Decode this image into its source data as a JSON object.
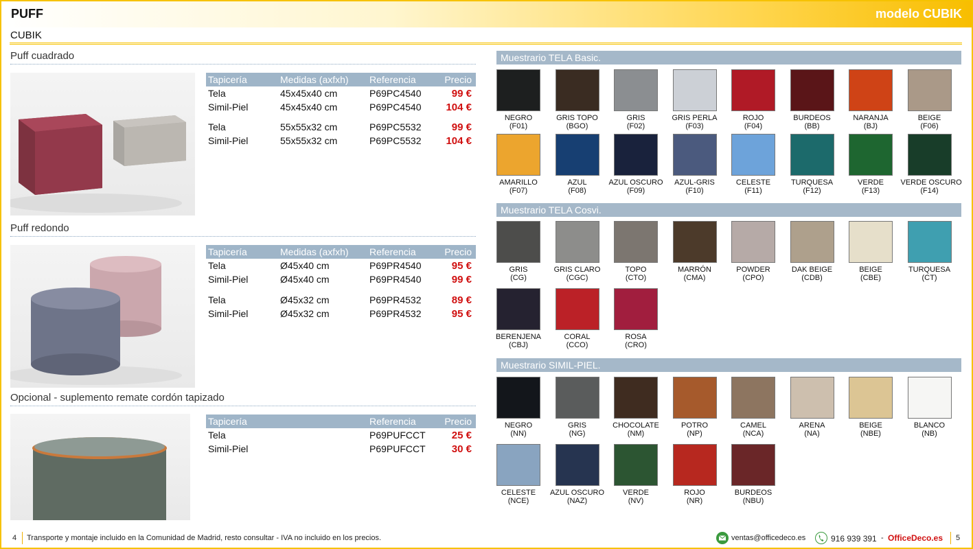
{
  "header": {
    "title": "PUFF",
    "model": "modelo CUBIK"
  },
  "subtitle": "CUBIK",
  "sections": [
    {
      "title": "Puff cuadrado",
      "headers": [
        "Tapicería",
        "Medidas (axfxh)",
        "Referencia",
        "Precio"
      ],
      "rows": [
        [
          "Tela",
          "45x45x40 cm",
          "P69PC4540",
          "99 €"
        ],
        [
          "Simil-Piel",
          "45x45x40 cm",
          "P69PC4540",
          "104 €"
        ],
        [
          "Tela",
          "55x55x32 cm",
          "P69PC5532",
          "99 €"
        ],
        [
          "Simil-Piel",
          "55x55x32 cm",
          "P69PC5532",
          "104 €"
        ]
      ]
    },
    {
      "title": "Puff redondo",
      "headers": [
        "Tapicería",
        "Medidas (axfxh)",
        "Referencia",
        "Precio"
      ],
      "rows": [
        [
          "Tela",
          "Ø45x40 cm",
          "P69PR4540",
          "95 €"
        ],
        [
          "Simil-Piel",
          "Ø45x40 cm",
          "P69PR4540",
          "99 €"
        ],
        [
          "Tela",
          "Ø45x32 cm",
          "P69PR4532",
          "89 €"
        ],
        [
          "Simil-Piel",
          "Ø45x32 cm",
          "P69PR4532",
          "95 €"
        ]
      ]
    },
    {
      "title": "Opcional - suplemento remate cordón tapizado",
      "headers": [
        "Tapicería",
        "Referencia",
        "Precio"
      ],
      "rows": [
        [
          "Tela",
          "P69PUFCCT",
          "25 €"
        ],
        [
          "Simil-Piel",
          "P69PUFCCT",
          "30 €"
        ]
      ]
    }
  ],
  "swatch_groups": [
    {
      "title": "Muestrario TELA Basic.",
      "items": [
        {
          "name": "NEGRO",
          "code": "(F01)",
          "color": "#1d1f1f"
        },
        {
          "name": "GRIS TOPO",
          "code": "(BGO)",
          "color": "#3a2c22"
        },
        {
          "name": "GRIS",
          "code": "(F02)",
          "color": "#8b8e91"
        },
        {
          "name": "GRIS PERLA",
          "code": "(F03)",
          "color": "#ccd0d6"
        },
        {
          "name": "ROJO",
          "code": "(F04)",
          "color": "#b01a26"
        },
        {
          "name": "BURDEOS",
          "code": "(BB)",
          "color": "#5a1518"
        },
        {
          "name": "NARANJA",
          "code": "(BJ)",
          "color": "#cf4316"
        },
        {
          "name": "BEIGE",
          "code": "(F06)",
          "color": "#aa9988"
        },
        {
          "name": "AMARILLO",
          "code": "(F07)",
          "color": "#eca52e"
        },
        {
          "name": "AZUL",
          "code": "(F08)",
          "color": "#173f72"
        },
        {
          "name": "AZUL OSCURO",
          "code": "(F09)",
          "color": "#19223c"
        },
        {
          "name": "AZUL-GRIS",
          "code": "(F10)",
          "color": "#4b5a7e"
        },
        {
          "name": "CELESTE",
          "code": "(F11)",
          "color": "#6da3da"
        },
        {
          "name": "TURQUESA",
          "code": "(F12)",
          "color": "#1c6a6b"
        },
        {
          "name": "VERDE",
          "code": "(F13)",
          "color": "#1e6630"
        },
        {
          "name": "VERDE OSCURO",
          "code": "(F14)",
          "color": "#183d29"
        }
      ]
    },
    {
      "title": "Muestrario TELA Cosvi.",
      "items": [
        {
          "name": "GRIS",
          "code": "(CG)",
          "color": "#4d4d4b"
        },
        {
          "name": "GRIS CLARO",
          "code": "(CGC)",
          "color": "#8d8d8b"
        },
        {
          "name": "TOPO",
          "code": "(CTO)",
          "color": "#7c7670"
        },
        {
          "name": "MARRÓN",
          "code": "(CMA)",
          "color": "#4c3a2a"
        },
        {
          "name": "POWDER",
          "code": "(CPO)",
          "color": "#b6aaa7"
        },
        {
          "name": "DAK BEIGE",
          "code": "(CDB)",
          "color": "#aea08c"
        },
        {
          "name": "BEIGE",
          "code": "(CBE)",
          "color": "#e6dfca"
        },
        {
          "name": "TURQUESA",
          "code": "(CT)",
          "color": "#3f9fb0"
        },
        {
          "name": "BERENJENA",
          "code": "(CBJ)",
          "color": "#252230"
        },
        {
          "name": "CORAL",
          "code": "(CCO)",
          "color": "#bb2127"
        },
        {
          "name": "ROSA",
          "code": "(CRO)",
          "color": "#a11e3e"
        }
      ]
    },
    {
      "title": "Muestrario SIMIL-PIEL.",
      "items": [
        {
          "name": "NEGRO",
          "code": "(NN)",
          "color": "#13161b"
        },
        {
          "name": "GRIS",
          "code": "(NG)",
          "color": "#5a5c5c"
        },
        {
          "name": "CHOCOLATE",
          "code": "(NM)",
          "color": "#3f2c20"
        },
        {
          "name": "POTRO",
          "code": "(NP)",
          "color": "#a65a2c"
        },
        {
          "name": "CAMEL",
          "code": "(NCA)",
          "color": "#8d7560"
        },
        {
          "name": "ARENA",
          "code": "(NA)",
          "color": "#cdbfae"
        },
        {
          "name": "BEIGE",
          "code": "(NBE)",
          "color": "#dcc594"
        },
        {
          "name": "BLANCO",
          "code": "(NB)",
          "color": "#f6f6f4"
        },
        {
          "name": "CELESTE",
          "code": "(NCE)",
          "color": "#89a4c0"
        },
        {
          "name": "AZUL OSCURO",
          "code": "(NAZ)",
          "color": "#263450"
        },
        {
          "name": "VERDE",
          "code": "(NV)",
          "color": "#2c5532"
        },
        {
          "name": "ROJO",
          "code": "(NR)",
          "color": "#b7281f"
        },
        {
          "name": "BURDEOS",
          "code": "(NBU)",
          "color": "#6a2628"
        }
      ]
    }
  ],
  "footer": {
    "page_left": "4",
    "text": "Transporte y montaje incluido en la Comunidad de Madrid, resto consultar - IVA no incluido en los precios.",
    "email": "ventas@officedeco.es",
    "phone": "916 939 391",
    "dash": "-",
    "brand": "OfficeDeco.es",
    "page_right": "5"
  }
}
